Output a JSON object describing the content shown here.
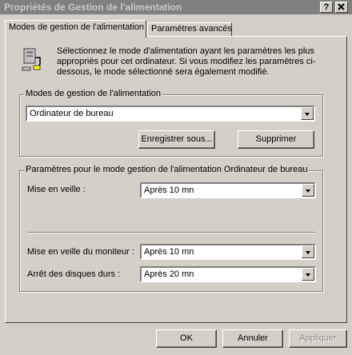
{
  "window": {
    "title": "Propriétés de Gestion de l'alimentation",
    "help_label": "?",
    "close_label": "x"
  },
  "tabs": [
    {
      "label": "Modes de gestion de l'alimentation",
      "active": true
    },
    {
      "label": "Paramètres avancés",
      "active": false
    }
  ],
  "intro_text": "Sélectionnez le mode d'alimentation ayant les paramètres les plus appropriés pour cet ordinateur. Si vous modifiez les paramètres ci-dessous, le mode sélectionné sera également modifié.",
  "modes_group": {
    "legend": "Modes de gestion de l'alimentation",
    "selected_mode": "Ordinateur de bureau",
    "save_as_label": "Enregistrer sous...",
    "delete_label": "Supprimer"
  },
  "settings_group": {
    "legend": "Paramètres pour le mode gestion de l'alimentation Ordinateur de bureau",
    "standby_label": "Mise en veille :",
    "standby_value": "Après 10 mn",
    "monitor_label": "Mise en veille du moniteur :",
    "monitor_value": "Après 10 mn",
    "disks_label": "Arrêt des disques durs :",
    "disks_value": "Après 20 mn"
  },
  "footer": {
    "ok_label": "OK",
    "cancel_label": "Annuler",
    "apply_label": "Appliquer"
  },
  "icon": "power-computer-icon"
}
